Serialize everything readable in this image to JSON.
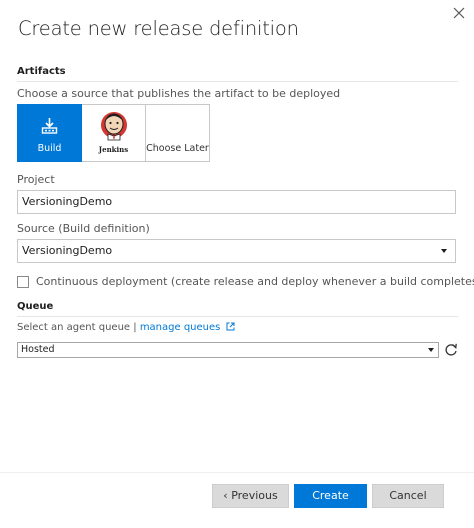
{
  "dialog": {
    "title": "Create new release definition"
  },
  "artifacts": {
    "section_label": "Artifacts",
    "help_text": "Choose a source that publishes the artifact to be deployed",
    "tiles": [
      {
        "label": "Build",
        "icon": "build-icon",
        "selected": true
      },
      {
        "label": "Jenkins",
        "icon": "jenkins-logo",
        "selected": false
      },
      {
        "label": "Choose Later",
        "icon": "",
        "selected": false
      }
    ],
    "project": {
      "label": "Project",
      "value": "VersioningDemo"
    },
    "source": {
      "label": "Source (Build definition)",
      "value": "VersioningDemo"
    },
    "continuous_deployment": {
      "label": "Continuous deployment (create release and deploy whenever a build completes)",
      "checked": false
    }
  },
  "queue": {
    "section_label": "Queue",
    "help_text": "Select an agent queue |",
    "manage_link": "manage queues",
    "selected": "Hosted"
  },
  "footer": {
    "previous_label": "Previous",
    "create_label": "Create",
    "cancel_label": "Cancel"
  },
  "colors": {
    "accent": "#0078d7",
    "secondary_button": "#dadada"
  }
}
